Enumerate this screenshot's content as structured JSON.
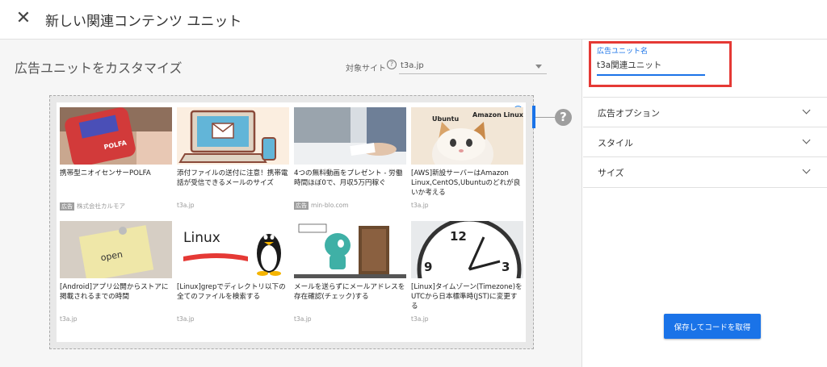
{
  "header": {
    "title": "新しい関連コンテンツ ユニット",
    "close_icon": "close-icon"
  },
  "main": {
    "section_title": "広告ユニットをカスタマイズ",
    "site_label": "対象サイト",
    "site_value": "t3a.jp",
    "preview": {
      "cards": [
        {
          "title": "携帯型ニオイセンサーPOLFA",
          "meta": "株式会社カルモア",
          "ad_badge": "広告"
        },
        {
          "title": "添付ファイルの送付に注意！携帯電話が受信できるメールのサイズ",
          "meta": "t3a.jp"
        },
        {
          "title": "4つの無料動画をプレゼント - 労働時間ほぼ0で、月収5万円稼ぐ",
          "meta": "min-blo.com",
          "ad_badge": "広告"
        },
        {
          "title": "[AWS]新設サーバーはAmazon Linux,CentOS,Ubuntuのどれが良いか考える",
          "meta": "t3a.jp"
        },
        {
          "title": "[Android]アプリ公開からストアに掲載されるまでの時間",
          "meta": "t3a.jp"
        },
        {
          "title": "[Linux]grepでディレクトリ以下の全てのファイルを検索する",
          "meta": "t3a.jp"
        },
        {
          "title": "メールを送らずにメールアドレスを存在確認(チェック)する",
          "meta": "t3a.jp"
        },
        {
          "title": "[Linux]タイムゾーン(Timezone)をUTCから日本標準時(JST)に変更する",
          "meta": "t3a.jp"
        }
      ],
      "thumb_texts": {
        "polfa": "POLFA",
        "ubuntu": "Ubuntu",
        "amazon_linux": "Amazon Linux",
        "linux": "Linux",
        "open": "open",
        "clock_12": "12",
        "clock_9": "9",
        "clock_3": "3"
      },
      "help_icon": "?"
    }
  },
  "sidebar": {
    "name_label": "広告ユニット名",
    "name_value": "t3a関連ユニット",
    "accordions": [
      {
        "label": "広告オプション"
      },
      {
        "label": "スタイル"
      },
      {
        "label": "サイズ"
      }
    ],
    "save_label": "保存してコードを取得"
  },
  "colors": {
    "accent": "#1a73e8",
    "highlight_border": "#e53935",
    "panel_bg": "#f6f6f6"
  }
}
